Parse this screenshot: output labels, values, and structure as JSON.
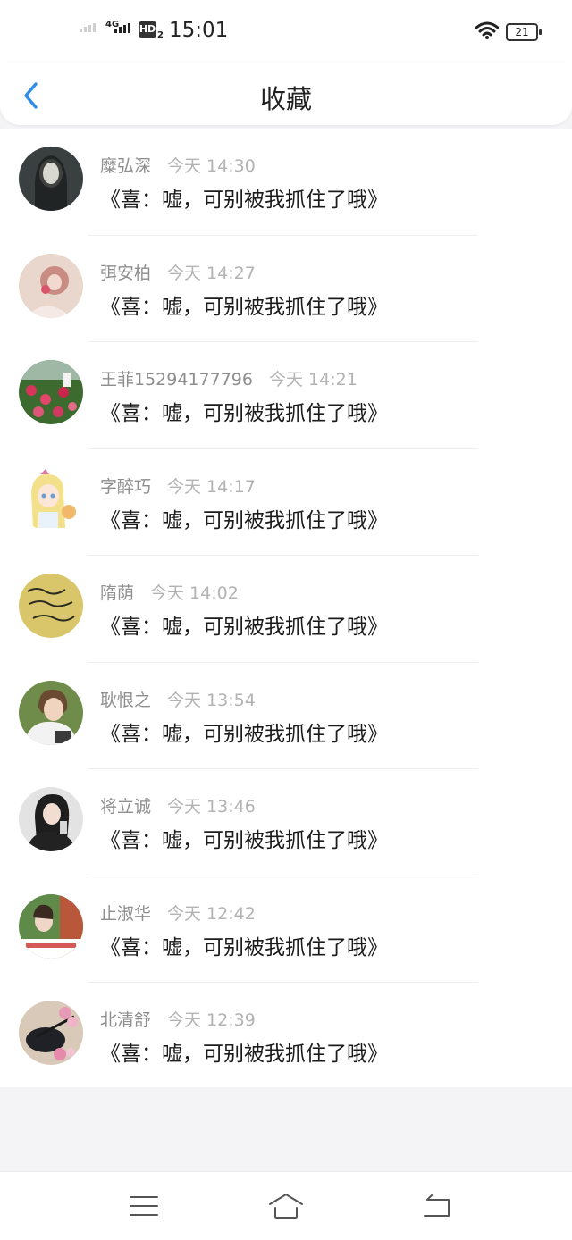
{
  "status_bar": {
    "network": "4G",
    "hd_label": "HD",
    "hd_sub": "2",
    "time": "15:01",
    "battery": "21"
  },
  "header": {
    "title": "收藏",
    "back_icon": "chevron-left-icon"
  },
  "colors": {
    "accent": "#2e8ee8",
    "name_text": "#8e8e8e",
    "time_text": "#b3b3b3",
    "content_text": "#1b1b1b"
  },
  "favorites": [
    {
      "name": "糜弘深",
      "time": "今天 14:30",
      "content": "《喜：嘘，可别被我抓住了哦》"
    },
    {
      "name": "弭安柏",
      "time": "今天 14:27",
      "content": "《喜：嘘，可别被我抓住了哦》"
    },
    {
      "name": "王菲15294177796",
      "time": "今天 14:21",
      "content": "《喜：嘘，可别被我抓住了哦》"
    },
    {
      "name": "字醉巧",
      "time": "今天 14:17",
      "content": "《喜：嘘，可别被我抓住了哦》"
    },
    {
      "name": "隋荫",
      "time": "今天 14:02",
      "content": "《喜：嘘，可别被我抓住了哦》"
    },
    {
      "name": "耿恨之",
      "time": "今天 13:54",
      "content": "《喜：嘘，可别被我抓住了哦》"
    },
    {
      "name": "将立诚",
      "time": "今天 13:46",
      "content": "《喜：嘘，可别被我抓住了哦》"
    },
    {
      "name": "止淑华",
      "time": "今天 12:42",
      "content": "《喜：嘘，可别被我抓住了哦》"
    },
    {
      "name": "北清舒",
      "time": "今天 12:39",
      "content": "《喜：嘘，可别被我抓住了哦》"
    }
  ],
  "nav_bar": {
    "menu_icon": "menu-icon",
    "home_icon": "home-icon",
    "back_icon": "back-icon"
  }
}
